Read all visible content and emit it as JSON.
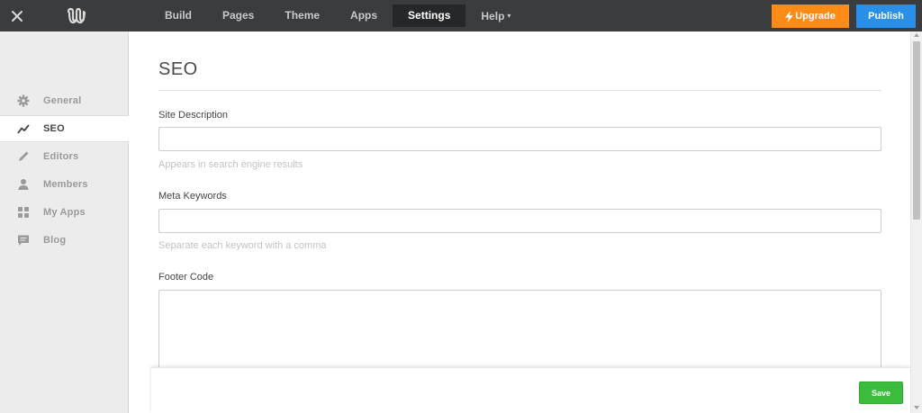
{
  "header": {
    "close_icon": "close-icon",
    "logo_icon": "weebly-logo-icon",
    "nav": [
      {
        "label": "Build",
        "active": false
      },
      {
        "label": "Pages",
        "active": false
      },
      {
        "label": "Theme",
        "active": false
      },
      {
        "label": "Apps",
        "active": false
      },
      {
        "label": "Settings",
        "active": true
      },
      {
        "label": "Help",
        "active": false,
        "caret": "▾"
      }
    ],
    "upgrade_label": "Upgrade",
    "upgrade_icon": "lightning-icon",
    "upgrade_color": "#ff8b17",
    "publish_label": "Publish",
    "publish_color": "#2990ea"
  },
  "sidebar": {
    "items": [
      {
        "label": "General",
        "icon": "gear-icon",
        "active": false
      },
      {
        "label": "SEO",
        "icon": "trend-line-icon",
        "active": true
      },
      {
        "label": "Editors",
        "icon": "pencil-icon",
        "active": false
      },
      {
        "label": "Members",
        "icon": "person-icon",
        "active": false
      },
      {
        "label": "My Apps",
        "icon": "grid-icon",
        "active": false
      },
      {
        "label": "Blog",
        "icon": "comment-icon",
        "active": false
      }
    ]
  },
  "main": {
    "title": "SEO",
    "site_description": {
      "label": "Site Description",
      "value": "",
      "help": "Appears in search engine results"
    },
    "meta_keywords": {
      "label": "Meta Keywords",
      "value": "",
      "help": "Separate each keyword with a comma"
    },
    "footer_code": {
      "label": "Footer Code",
      "value": ""
    }
  },
  "savebar": {
    "save_label": "Save",
    "save_color": "#3cbc3c"
  }
}
